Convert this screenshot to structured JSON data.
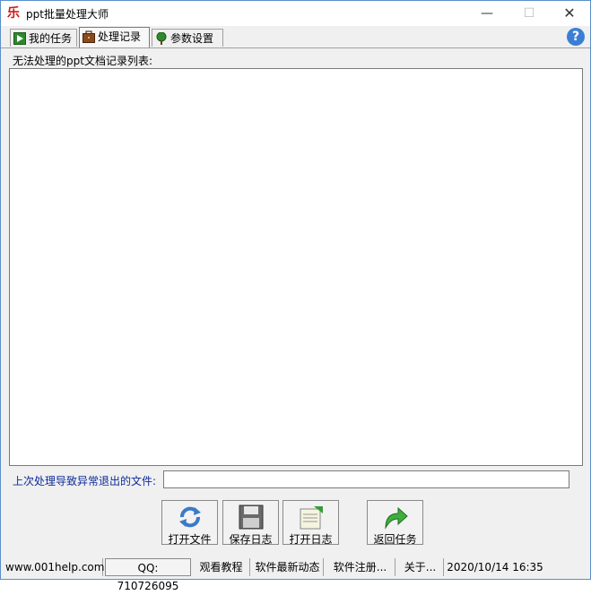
{
  "window": {
    "title": "ppt批量处理大师",
    "app_icon_glyph": "乐",
    "minimize_glyph": "—",
    "maximize_glyph": "☐",
    "close_glyph": "✕"
  },
  "tabs": [
    {
      "label": "我的任务",
      "icon": "play-icon"
    },
    {
      "label": "处理记录",
      "icon": "briefcase-icon"
    },
    {
      "label": "参数设置",
      "icon": "tree-icon"
    }
  ],
  "help_glyph": "?",
  "main": {
    "list_label": "无法处理的ppt文档记录列表:",
    "crash_label": "上次处理导致异常退出的文件:",
    "crash_value": ""
  },
  "buttons": {
    "open_file": "打开文件",
    "save_log": "保存日志",
    "open_log": "打开日志",
    "back_task": "返回任务"
  },
  "statusbar": {
    "website": "www.001help.com",
    "qq": "QQ: 710726095",
    "tutorial": "观看教程",
    "news": "软件最新动态",
    "register": "软件注册...",
    "about": "关于...",
    "datetime": "2020/10/14   16:35"
  },
  "colors": {
    "accent_blue": "#0a2a9a",
    "window_border": "#5a8fc8",
    "help_blue": "#3b7fd4"
  }
}
